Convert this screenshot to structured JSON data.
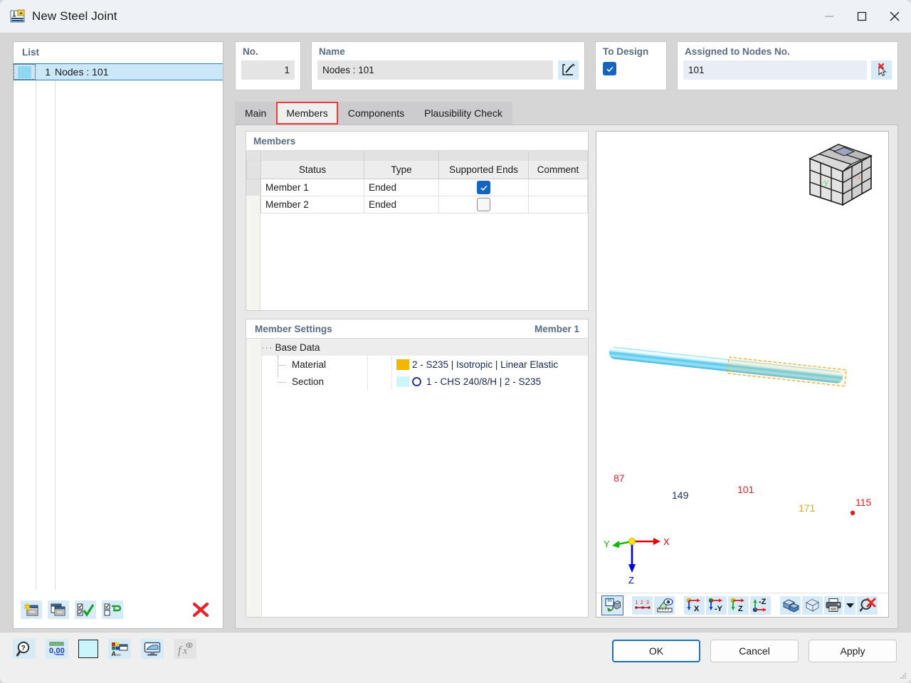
{
  "window": {
    "title": "New Steel Joint",
    "icon": "steel-joint-icon",
    "minimize": "—",
    "maximize": "□",
    "close": "✕"
  },
  "list": {
    "label": "List",
    "rows": [
      {
        "number": "1",
        "name": "Nodes : 101",
        "swatch_color": "#8ed8f3"
      }
    ],
    "toolbar": [
      {
        "name": "new-item-button",
        "icon": "new-window-icon"
      },
      {
        "name": "copy-item-button",
        "icon": "copy-window-icon"
      },
      {
        "name": "select-all-button",
        "icon": "check-all-icon"
      },
      {
        "name": "invert-selection-button",
        "icon": "invert-selection-icon"
      },
      {
        "name": "delete-item-button",
        "icon": "red-x-icon"
      }
    ]
  },
  "fields": {
    "no_label": "No.",
    "no_value": "1",
    "name_label": "Name",
    "name_value": "Nodes : 101",
    "name_edit_icon": "edit-pencil-icon",
    "to_design_label": "To Design",
    "to_design_checked": true,
    "assigned_label": "Assigned to Nodes No.",
    "assigned_value": "101",
    "assigned_pick_icon": "cursor-deselect-icon"
  },
  "tabs": {
    "items": [
      {
        "label": "Main",
        "active": false
      },
      {
        "label": "Members",
        "active": true,
        "highlighted": true
      },
      {
        "label": "Components",
        "active": false
      },
      {
        "label": "Plausibility Check",
        "active": false
      }
    ]
  },
  "members": {
    "title": "Members",
    "columns": [
      "Status",
      "Type",
      "Supported Ends",
      "Comment"
    ],
    "rows": [
      {
        "status": "Member 1",
        "type": "Ended",
        "supported_ends": true,
        "comment": ""
      },
      {
        "status": "Member 2",
        "type": "Ended",
        "supported_ends": false,
        "comment": ""
      }
    ]
  },
  "member_settings": {
    "title": "Member Settings",
    "current": "Member 1",
    "group": "Base Data",
    "expander": "−",
    "rows": [
      {
        "name": "Material",
        "color": "#f5b400",
        "value": "2 - S235 | Isotropic | Linear Elastic",
        "shape": "none"
      },
      {
        "name": "Section",
        "color": "#cdf6fb",
        "value": "1 - CHS 240/8/H | 2 - S235",
        "shape": "circle"
      }
    ]
  },
  "viewport": {
    "nav_cube": {
      "face_left": "-y",
      "face_right": "-x"
    },
    "axes": {
      "x": "X",
      "y": "Y",
      "z": "Z",
      "x_color": "#e00000",
      "y_color": "#00c000",
      "z_color": "#0000e0"
    },
    "model_labels": [
      {
        "text": "87",
        "color": "#e02020"
      },
      {
        "text": "149",
        "color": "#15306b"
      },
      {
        "text": "101",
        "color": "#e02020"
      },
      {
        "text": "171",
        "color": "#e8a317"
      },
      {
        "text": "115",
        "color": "#e02020"
      }
    ],
    "toolbar": [
      {
        "name": "render-toggle-button",
        "icon": "render-toggle-icon",
        "selected": true
      },
      {
        "name": "numbering-button",
        "icon": "numbering-123-icon",
        "selected": false
      },
      {
        "name": "view-visibility-button",
        "icon": "ruler-eye-icon",
        "selected": false
      },
      {
        "name": "view-in-x-button",
        "icon": "axis-x-icon",
        "selected": false
      },
      {
        "name": "view-in-negative-y-button",
        "icon": "axis-neg-y-icon",
        "selected": false
      },
      {
        "name": "view-in-z-button",
        "icon": "axis-z-icon",
        "selected": false
      },
      {
        "name": "view-in-negative-z-button",
        "icon": "axis-neg-z-icon",
        "selected": false
      },
      {
        "name": "solid-model-button",
        "icon": "solid-blocks-icon",
        "selected": false
      },
      {
        "name": "wireframe-button",
        "icon": "wireframe-cube-icon",
        "selected": false
      },
      {
        "name": "print-button",
        "icon": "printer-icon",
        "selected": false
      },
      {
        "name": "print-dropdown-button",
        "icon": "chevron-down-icon",
        "selected": false
      },
      {
        "name": "clear-zoom-button",
        "icon": "magnifier-red-x-icon",
        "selected": false
      }
    ]
  },
  "bottom_bar": {
    "tools": [
      {
        "name": "help-button",
        "icon": "help-magnifier-icon"
      },
      {
        "name": "decimal-places-button",
        "icon": "decimal-0-00-icon"
      },
      {
        "name": "color-swatch-button",
        "icon": "cyan-swatch-icon"
      },
      {
        "name": "display-properties-button",
        "icon": "color-palette-icon"
      },
      {
        "name": "visual-settings-button",
        "icon": "monitor-icon"
      },
      {
        "name": "formula-button",
        "icon": "fx-icon"
      }
    ],
    "buttons": {
      "ok": "OK",
      "cancel": "Cancel",
      "apply": "Apply"
    }
  }
}
